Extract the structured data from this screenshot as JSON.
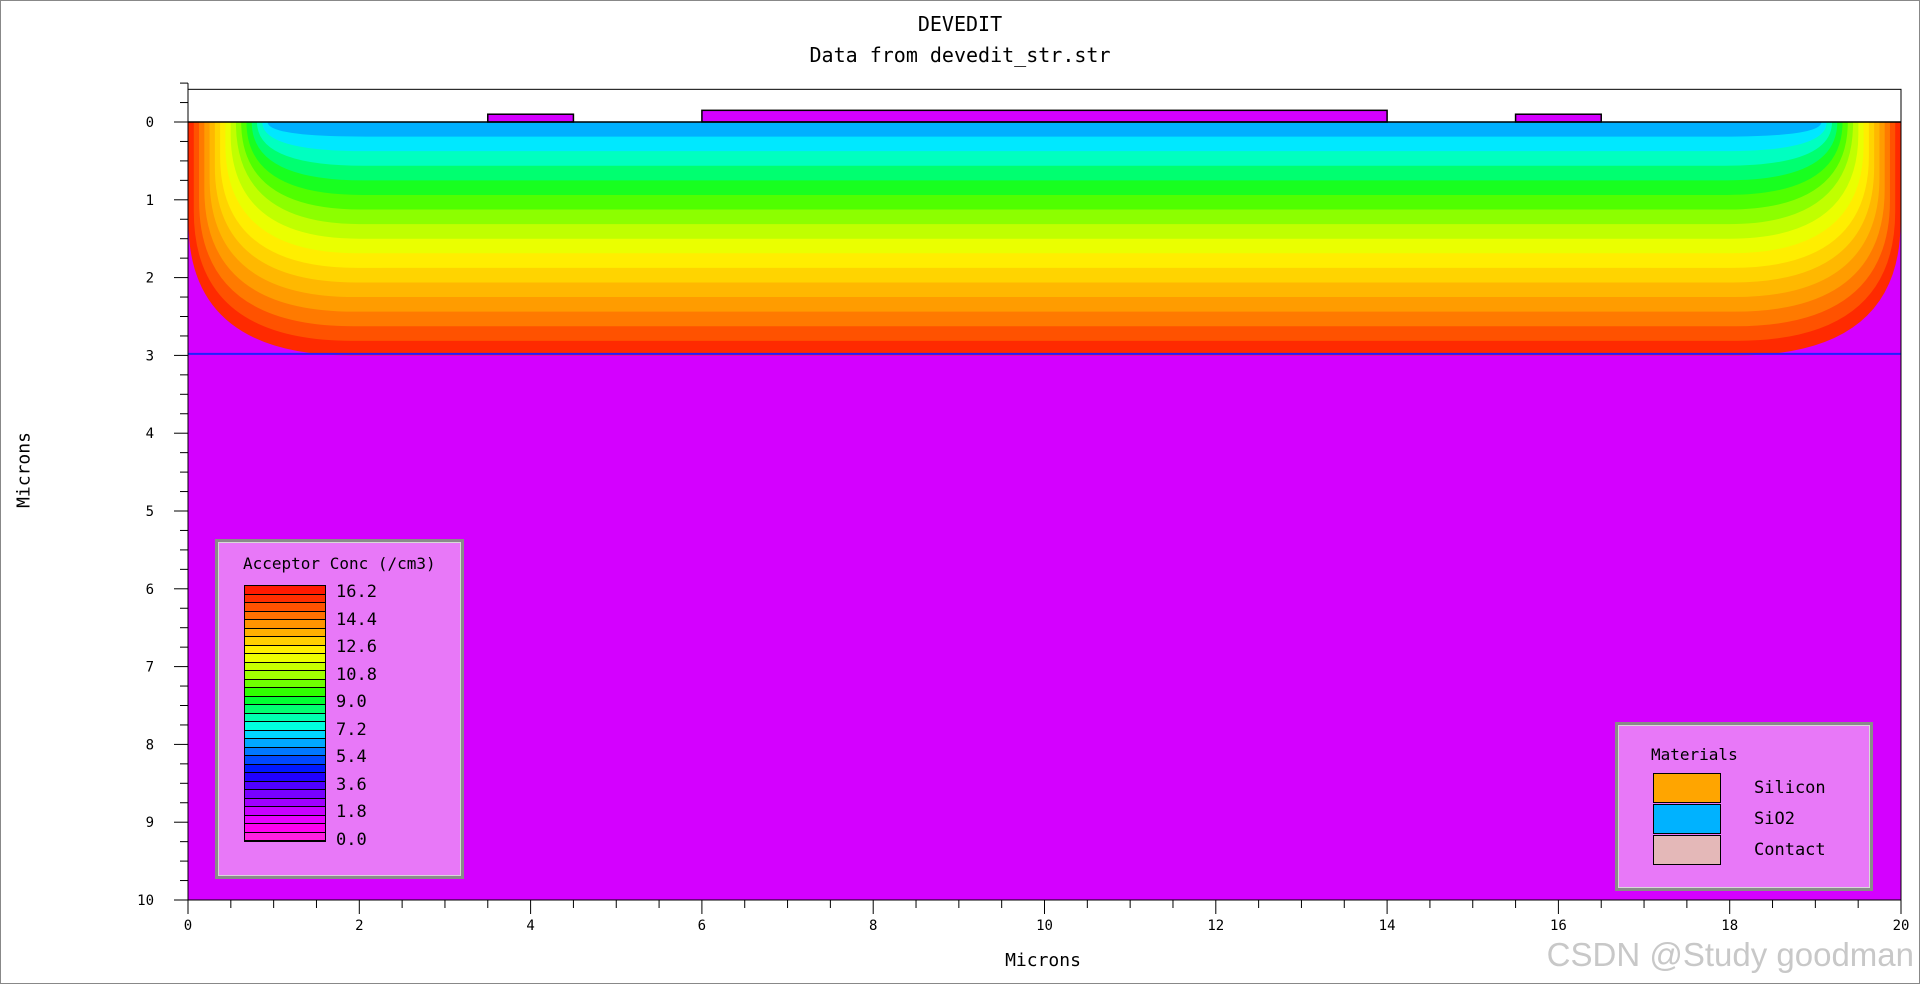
{
  "chart_data": {
    "type": "heatmap",
    "title": "DEVEDIT",
    "subtitle": "Data from devedit_str.str",
    "xlabel": "Microns",
    "ylabel": "Microns",
    "xlim": [
      0,
      20
    ],
    "ylim": [
      0,
      10
    ],
    "y_inverted": true,
    "x_ticks": [
      "0",
      "2",
      "4",
      "6",
      "8",
      "10",
      "12",
      "14",
      "16",
      "18",
      "20"
    ],
    "y_ticks": [
      "0",
      "1",
      "2",
      "3",
      "4",
      "5",
      "6",
      "7",
      "8",
      "9",
      "10"
    ],
    "oxide_pads": [
      {
        "x": [
          3.5,
          4.5
        ],
        "thickness": 0.1
      },
      {
        "x": [
          6.0,
          14.0
        ],
        "thickness": 0.15
      },
      {
        "x": [
          15.5,
          16.5
        ],
        "thickness": 0.1
      }
    ],
    "colorbar": {
      "title": "Acceptor Conc (/cm3)",
      "labels": [
        "16.2",
        "14.4",
        "12.6",
        "10.8",
        "9.0",
        "7.2",
        "5.4",
        "3.6",
        "1.8",
        "0.0"
      ],
      "colors": [
        "#ff1a00",
        "#ff2e00",
        "#ff5200",
        "#ff7000",
        "#ff9400",
        "#ffb000",
        "#ffd000",
        "#fff000",
        "#eeff00",
        "#c8ff00",
        "#a0ff00",
        "#70ff00",
        "#30ff00",
        "#00ff30",
        "#00ff70",
        "#00ffb0",
        "#00ffe0",
        "#00d8ff",
        "#00a8ff",
        "#0078ff",
        "#0048ff",
        "#0018ff",
        "#2000ff",
        "#5000ff",
        "#7800ff",
        "#a000ff",
        "#c800ff",
        "#e800ff",
        "#ff00f0",
        "#ff20e0"
      ]
    },
    "materials": {
      "title": "Materials",
      "items": [
        {
          "name": "Silicon",
          "color": "#ffa500"
        },
        {
          "name": "SiO2",
          "color": "#00b2ff"
        },
        {
          "name": "Contact",
          "color": "#e4b8b8"
        }
      ]
    }
  },
  "watermark": "CSDN @Study goodman"
}
